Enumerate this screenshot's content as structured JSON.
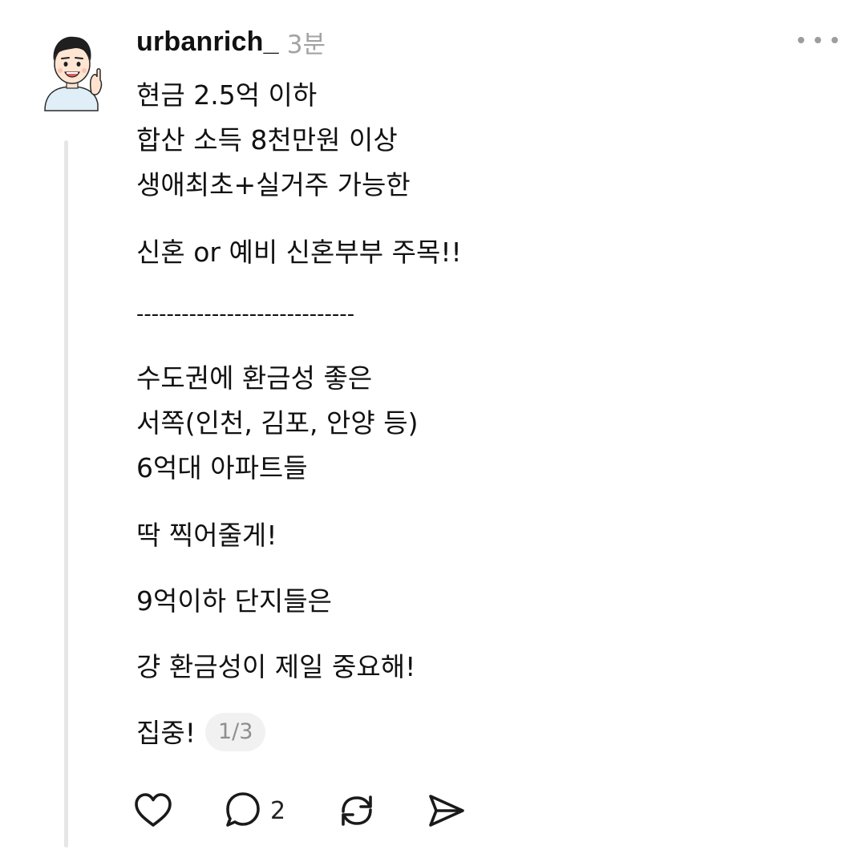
{
  "post": {
    "username": "urbanrich_",
    "time": "3분",
    "lines": [
      "현금 2.5억 이하",
      "합산 소득 8천만원 이상",
      "생애최초+실거주 가능한",
      "신혼 or 예비 신혼부부 주목!!",
      "-----------------------------",
      "수도권에 환금성 좋은",
      "서쪽(인천, 김포, 안양 등)",
      "6억대 아파트들",
      "딱 찍어줄게!",
      "9억이하 단지들은",
      "걍 환금성이 제일 중요해!",
      "집중!"
    ],
    "page_indicator": "1/3"
  },
  "actions": {
    "like_icon": "heart-icon",
    "comment_icon": "comment-bubble-icon",
    "comment_count": "2",
    "repost_icon": "repost-icon",
    "share_icon": "send-icon"
  },
  "colors": {
    "text": "#111111",
    "muted": "#a3a3a3",
    "thread_line": "#e6e6e6",
    "badge_bg": "#f1f1f1"
  }
}
